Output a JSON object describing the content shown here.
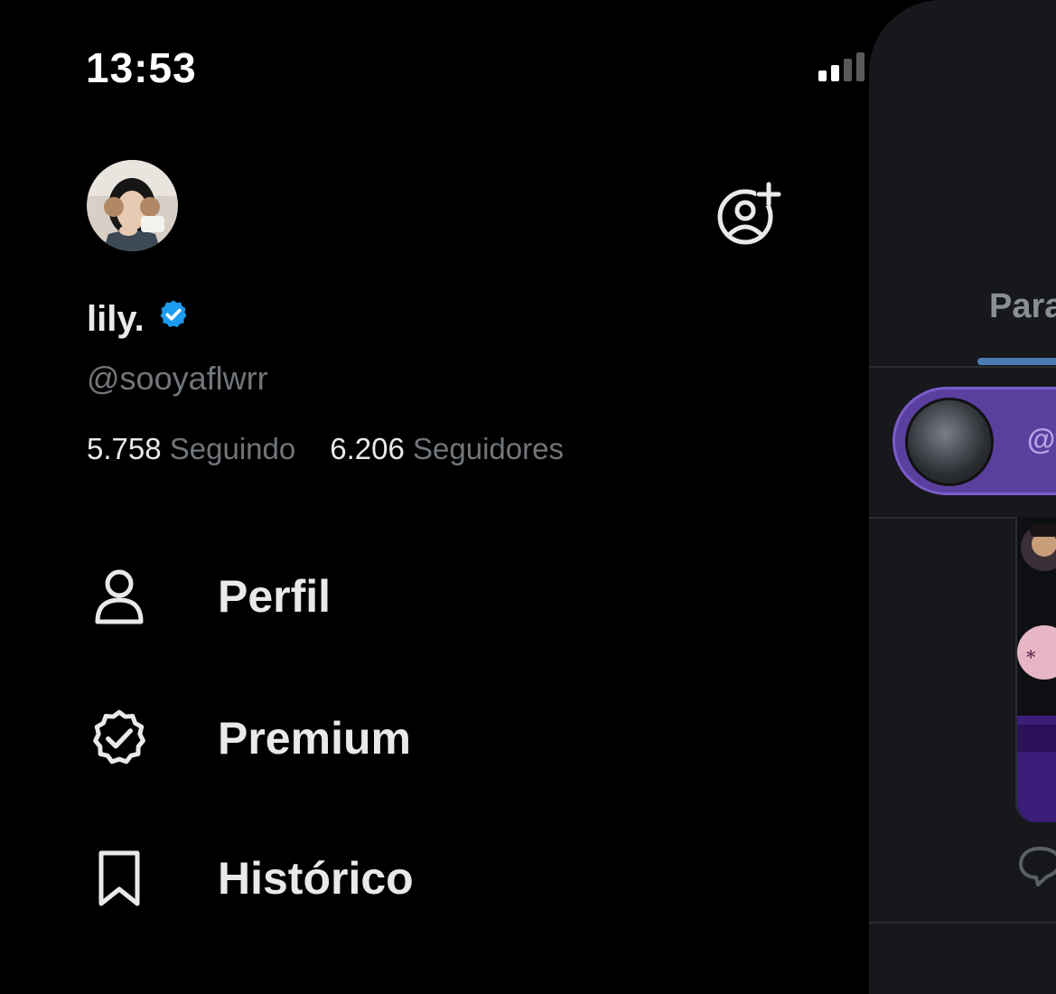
{
  "status_bar": {
    "time": "13:53"
  },
  "profile": {
    "name": "lily.",
    "handle": "@sooyaflwrr",
    "following_count": "5.758",
    "following_label": "Seguindo",
    "followers_count": "6.206",
    "followers_label": "Seguidores"
  },
  "menu": [
    {
      "label": "Perfil",
      "icon": "person-icon"
    },
    {
      "label": "Premium",
      "icon": "verified-badge-icon"
    },
    {
      "label": "Histórico",
      "icon": "bookmark-icon"
    }
  ],
  "feed_peek": {
    "tab_label": "Para",
    "space_handle": "@v"
  },
  "colors": {
    "background": "#000000",
    "text": "#e7e9ea",
    "muted": "#71767b",
    "verified_blue": "#1d9bf0",
    "space_purple": "#5b3f9e"
  }
}
